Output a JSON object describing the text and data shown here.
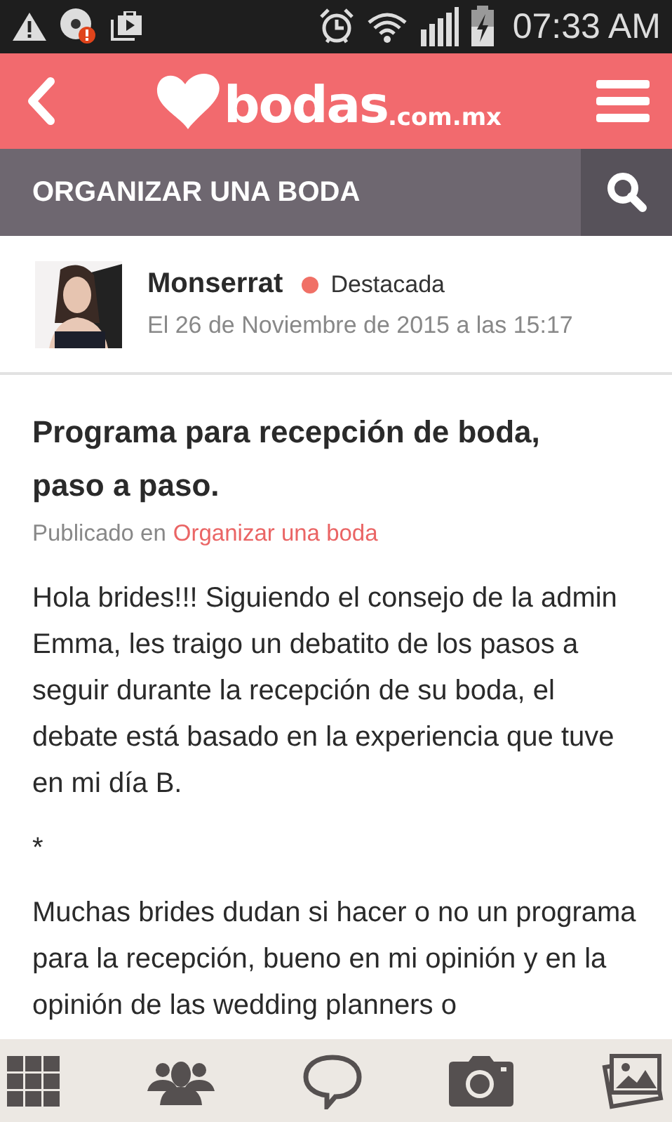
{
  "status_bar": {
    "time": "07:33 AM"
  },
  "header": {
    "logo_main": "bodas",
    "logo_suffix": ".com.mx"
  },
  "section": {
    "title": "ORGANIZAR UNA BODA"
  },
  "author": {
    "name": "Monserrat",
    "badge": "Destacada",
    "date": "El 26 de Noviembre de 2015 a las 15:17"
  },
  "article": {
    "title": "Programa para recepción de boda, paso a paso.",
    "published_prefix": "Publicado en",
    "category": "Organizar una boda",
    "paragraphs": [
      "Hola brides!!! Siguiendo el consejo de la admin Emma, les traigo un debatito de los pasos a seguir durante la recepción de su boda, el debate está basado en la experiencia que tuve en mi día B.",
      "*",
      "Muchas brides dudan si hacer o no un programa para la recepción, bueno en mi opinión y en la opinión de las wedding planners o"
    ]
  }
}
